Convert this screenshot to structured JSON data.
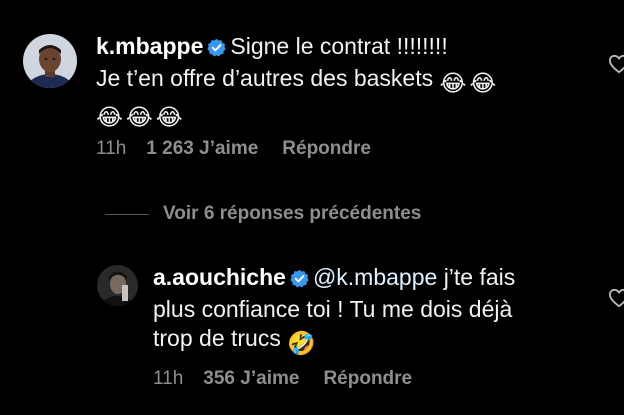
{
  "comments": [
    {
      "username": "k.mbappe",
      "verified": true,
      "text_line1": "Signe le contrat !!!!!!!!",
      "text_line2": "Je t’en offre d’autres des baskets",
      "emoji": [
        "😂",
        "😂",
        "😂",
        "😂",
        "😂"
      ],
      "time": "11h",
      "likes": "1 263 J’aime",
      "reply_label": "Répondre"
    },
    {
      "username": "a.aouchiche",
      "verified": true,
      "mention": "@k.mbappe",
      "text_line1": "j’te fais",
      "text_line2": "plus confiance toi ! Tu me dois déjà",
      "text_line3": "trop de trucs",
      "emoji": [
        "🤣"
      ],
      "time": "11h",
      "likes": "356 J’aime",
      "reply_label": "Répondre"
    }
  ],
  "view_replies_label": "Voir 6 réponses précédentes",
  "colors": {
    "background": "#000000",
    "text": "#f5f5f5",
    "secondary": "#8e8e8e",
    "verified": "#3897f0",
    "mention": "#e0f1ff"
  }
}
